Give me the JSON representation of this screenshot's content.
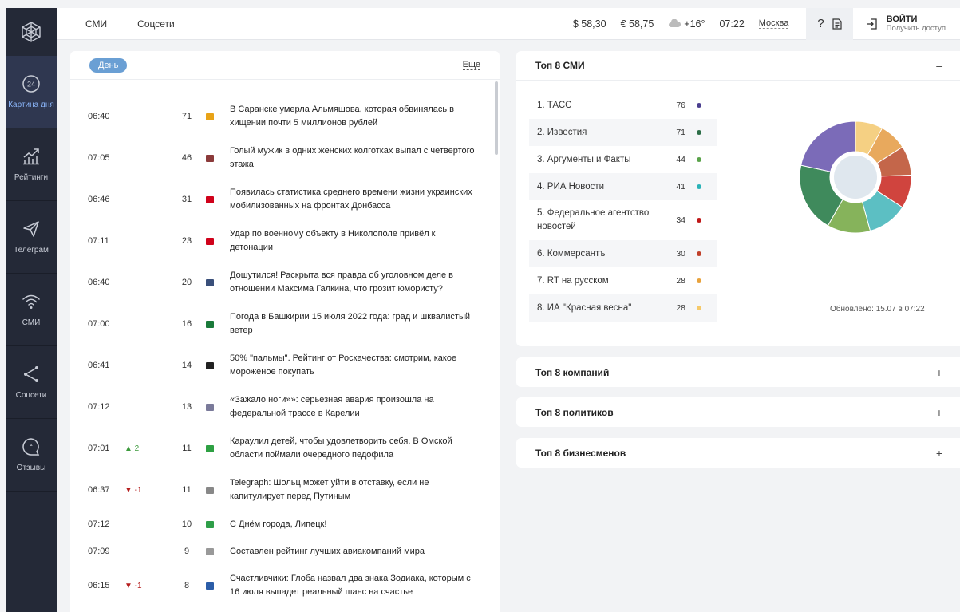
{
  "sidebar": {
    "items": [
      {
        "label": "Картина дня",
        "icon": "clock-24-icon"
      },
      {
        "label": "Рейтинги",
        "icon": "chart-trend-icon"
      },
      {
        "label": "Телеграм",
        "icon": "paper-plane-icon"
      },
      {
        "label": "СМИ",
        "icon": "wifi-icon"
      },
      {
        "label": "Соцсети",
        "icon": "share-icon"
      },
      {
        "label": "Отзывы",
        "icon": "quote-bubble-icon"
      }
    ]
  },
  "topbar": {
    "tab_media": "СМИ",
    "tab_social": "Соцсети",
    "usd": "$ 58,30",
    "eur": "€ 58,75",
    "weather": "+16°",
    "time": "07:22",
    "city": "Москва",
    "help": "?",
    "login_title": "ВОЙТИ",
    "login_sub": "Получить доступ"
  },
  "news": {
    "period_label": "День",
    "more_label": "Еще",
    "rows": [
      {
        "time": "06:40",
        "change": "",
        "count": "71",
        "title": "В Саранске умерла Альмяшова, которая обвинялась в хищении почти 5 миллионов рублей",
        "source_color": "#e8a317"
      },
      {
        "time": "07:05",
        "change": "",
        "count": "46",
        "title": "Голый мужик в одних женских колготках выпал с четвертого этажа",
        "source_color": "#8b3a3a"
      },
      {
        "time": "06:46",
        "change": "",
        "count": "31",
        "title": "Появилась статистика среднего времени жизни украинских мобилизованных на фронтах Донбасса",
        "source_color": "#d0021b"
      },
      {
        "time": "07:11",
        "change": "",
        "count": "23",
        "title": "Удар по военному объекту в Николополе привёл к детонации",
        "source_color": "#d0021b"
      },
      {
        "time": "06:40",
        "change": "",
        "count": "20",
        "title": "Дошутился! Раскрыта вся правда об уголовном деле в отношении Максима Галкина, что грозит юмористу?",
        "source_color": "#3a4f7a"
      },
      {
        "time": "07:00",
        "change": "",
        "count": "16",
        "title": "Погода в Башкирии 15 июля 2022 года: град и шквалистый ветер",
        "source_color": "#1a7a3a"
      },
      {
        "time": "06:41",
        "change": "",
        "count": "14",
        "title": "50% \"пальмы\". Рейтинг от Роскачества: смотрим, какое мороженое покупать",
        "source_color": "#222222"
      },
      {
        "time": "07:12",
        "change": "",
        "count": "13",
        "title": "«Зажало ноги»»: серьезная авария произошла на федеральной трассе в Карелии",
        "source_color": "#7a7a9a"
      },
      {
        "time": "07:01",
        "change": "▲ 2",
        "change_dir": "up",
        "count": "11",
        "title": "Караулил детей, чтобы удовлетворить себя. В Омской области поймали очередного педофила",
        "source_color": "#2ea043"
      },
      {
        "time": "06:37",
        "change": "▼ -1",
        "change_dir": "down",
        "count": "11",
        "title": "Telegraph: Шольц может уйти в отставку, если не капитулирует перед Путиным",
        "source_color": "#888888"
      },
      {
        "time": "07:12",
        "change": "",
        "count": "10",
        "title": "С Днём города, Липецк!",
        "source_color": "#2e9e48"
      },
      {
        "time": "07:09",
        "change": "",
        "count": "9",
        "title": "Составлен рейтинг лучших авиакомпаний мира",
        "source_color": "#999999"
      },
      {
        "time": "06:15",
        "change": "▼ -1",
        "change_dir": "down",
        "count": "8",
        "title": "Счастливчики: Глоба назвал два знака Зодиака, которым с 16 июля выпадет реальный шанс на счастье",
        "source_color": "#2b5da8"
      }
    ]
  },
  "top_smi": {
    "title": "Топ 8 СМИ",
    "collapse_sign": "–",
    "updated": "Обновлено: 15.07 в 07:22",
    "items": [
      {
        "name": "1. ТАСС",
        "value": "76",
        "color": "#4b3f8f"
      },
      {
        "name": "2. Известия",
        "value": "71",
        "color": "#2d6e48"
      },
      {
        "name": "3. Аргументы и Факты",
        "value": "44",
        "color": "#5aa34a"
      },
      {
        "name": "4. РИА Новости",
        "value": "41",
        "color": "#2bb3b8"
      },
      {
        "name": "5. Федеральное агентство новостей",
        "value": "34",
        "color": "#c01818"
      },
      {
        "name": "6. Коммерсантъ",
        "value": "30",
        "color": "#c0402a"
      },
      {
        "name": "7. RT на русском",
        "value": "28",
        "color": "#e8a23c"
      },
      {
        "name": "8. ИА \"Красная весна\"",
        "value": "28",
        "color": "#f5c96a"
      }
    ]
  },
  "chart_data": {
    "type": "pie",
    "categories": [
      "1. ТАСС",
      "2. Известия",
      "3. Аргументы и Факты",
      "4. РИА Новости",
      "5. Федеральное агентство новостей",
      "6. Коммерсантъ",
      "7. RT на русском",
      "8. ИА \"Красная весна\""
    ],
    "values": [
      76,
      71,
      44,
      41,
      34,
      30,
      28,
      28
    ],
    "colors": [
      "#7b6bb8",
      "#3f8a5c",
      "#86b35b",
      "#5cbfc3",
      "#d0443e",
      "#c4664a",
      "#e8a95d",
      "#f5d083"
    ],
    "title": ""
  },
  "accordions": [
    {
      "title": "Топ 8 компаний",
      "sign": "+"
    },
    {
      "title": "Топ 8 политиков",
      "sign": "+"
    },
    {
      "title": "Топ 8 бизнесменов",
      "sign": "+"
    }
  ]
}
